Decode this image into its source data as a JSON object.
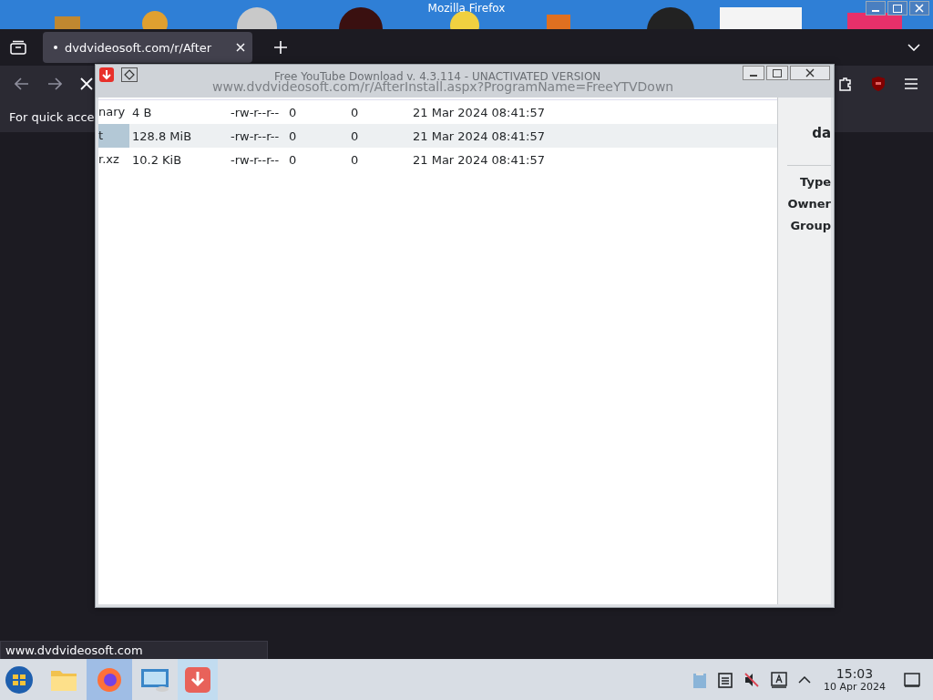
{
  "desktop_titlebar": {
    "title": "Mozilla Firefox"
  },
  "browser": {
    "tabs": [
      {
        "label": "dvdvideosoft.com/r/After",
        "selected": true
      }
    ],
    "bookmarks_hint": "For quick acce",
    "status_url": "www.dvdvideosoft.com"
  },
  "app_window": {
    "title": "Free YouTube Download v. 4.3.114 - UNACTIVATED VERSION",
    "address_behind": "www.dvdvideosoft.com/r/AfterInstall.aspx?ProgramName=FreeYTVDown",
    "rows": [
      {
        "name": "nary",
        "size": "4 B",
        "permissions": "-rw-r--r--",
        "column_4": "0",
        "column_5": "0",
        "modified": "21 Mar 2024 08:41:57",
        "selected": false
      },
      {
        "name": "t",
        "size": "128.8 MiB",
        "permissions": "-rw-r--r--",
        "column_4": "0",
        "column_5": "0",
        "modified": "21 Mar 2024 08:41:57",
        "selected": true
      },
      {
        "name": "r.xz",
        "size": "10.2 KiB",
        "permissions": "-rw-r--r--",
        "column_4": "0",
        "column_5": "0",
        "modified": "21 Mar 2024 08:41:57",
        "selected": false
      }
    ],
    "side_panel": {
      "heading": "da",
      "labels": [
        "Type",
        "Owner",
        "Group"
      ]
    }
  },
  "taskbar": {
    "apps": [
      {
        "kind": "files",
        "selected": false
      },
      {
        "kind": "firefox",
        "selected": true
      },
      {
        "kind": "control-panel",
        "selected": false
      },
      {
        "kind": "downloader",
        "selected": true
      }
    ],
    "clock": {
      "time": "15:03",
      "date": "10 Apr 2024"
    }
  }
}
